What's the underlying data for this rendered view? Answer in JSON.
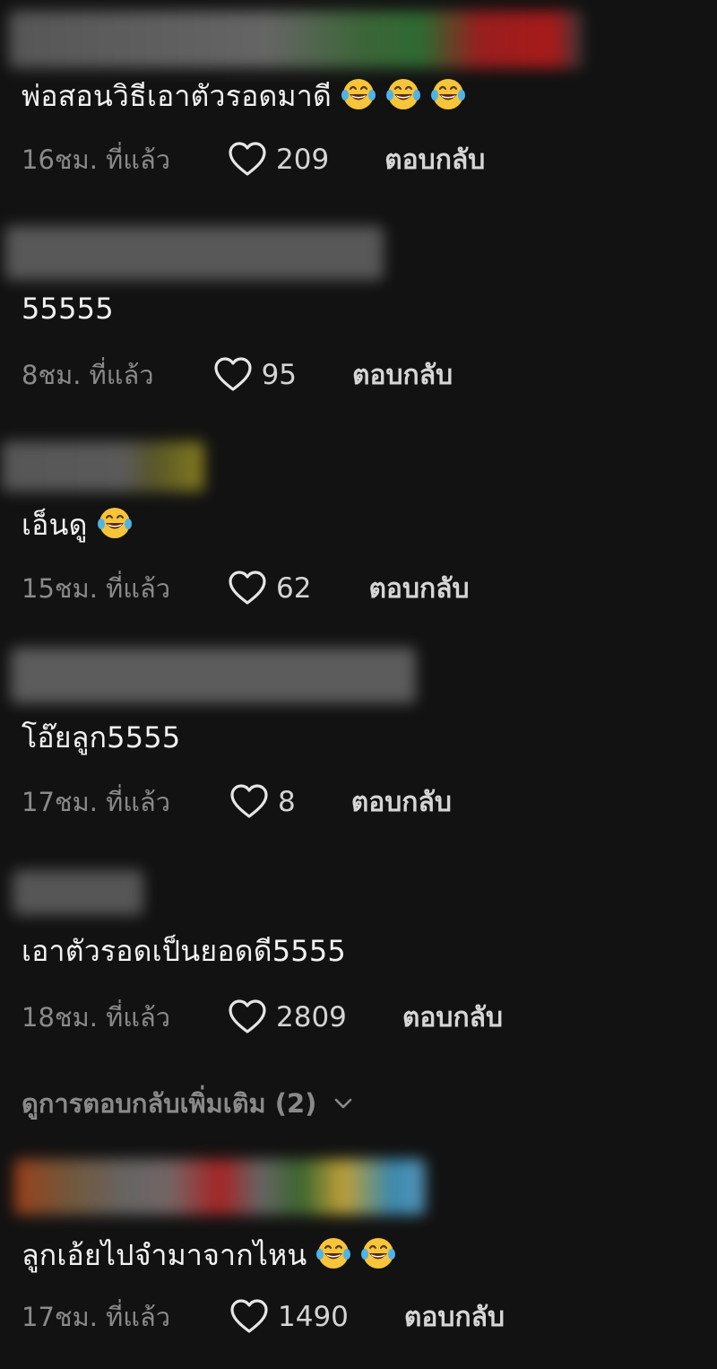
{
  "comments": [
    {
      "text": "พ่อสอนวิธีเอาตัวรอดมาดี",
      "emoji_count": 3,
      "time": "16ชม. ที่แล้ว",
      "likes": "209",
      "reply_label": "ตอบกลับ"
    },
    {
      "text": "55555",
      "emoji_count": 0,
      "time": "8ชม. ที่แล้ว",
      "likes": "95",
      "reply_label": "ตอบกลับ"
    },
    {
      "text": "เอ็นดู",
      "emoji_count": 1,
      "time": "15ชม. ที่แล้ว",
      "likes": "62",
      "reply_label": "ตอบกลับ"
    },
    {
      "text": "โอ๊ยลูก5555",
      "emoji_count": 0,
      "time": "17ชม. ที่แล้ว",
      "likes": "8",
      "reply_label": "ตอบกลับ"
    },
    {
      "text": "เอาตัวรอดเป็นยอดดี5555",
      "emoji_count": 0,
      "time": "18ชม. ที่แล้ว",
      "likes": "2809",
      "reply_label": "ตอบกลับ"
    },
    {
      "text": "ลูกเอ้ยไปจำมาจากไหน",
      "emoji_count": 2,
      "time": "17ชม. ที่แล้ว",
      "likes": "1490",
      "reply_label": "ตอบกลับ"
    }
  ],
  "view_more_replies": "ดูการตอบกลับเพิ่มเติม (2)",
  "icons": {
    "like": "heart-outline-icon",
    "emoji": "tears-of-joy-emoji-icon",
    "expand": "chevron-down-icon"
  },
  "colors": {
    "background": "#121212",
    "text": "#f2f2f2",
    "muted": "#8a8a8a"
  }
}
